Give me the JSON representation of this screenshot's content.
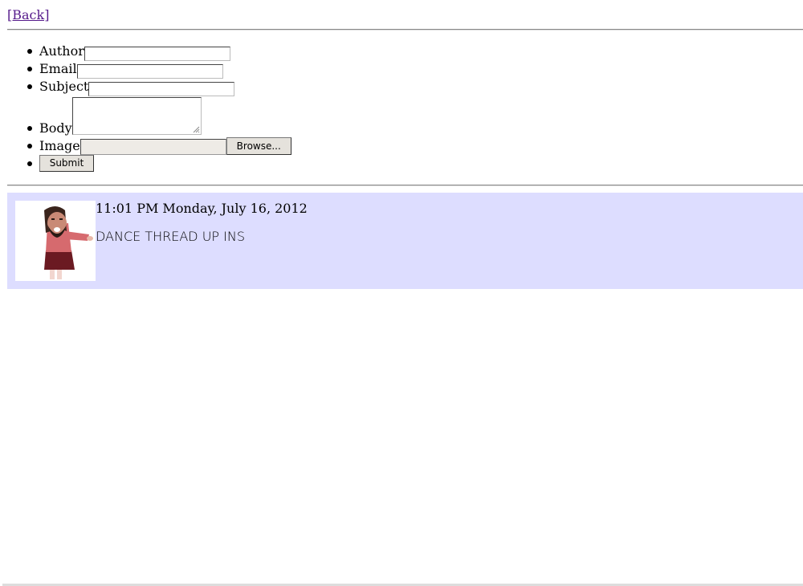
{
  "nav": {
    "back_label": "[Back]"
  },
  "form": {
    "author_label": "Author",
    "email_label": "Email",
    "subject_label": "Subject",
    "body_label": "Body",
    "image_label": "Image",
    "browse_label": "Browse...",
    "submit_label": "Submit",
    "author_value": "",
    "email_value": "",
    "subject_value": ""
  },
  "post": {
    "timestamp": "11:01 PM Monday, July 16, 2012",
    "body": "DANCE THREAD UP INS"
  },
  "colors": {
    "post_bg": "#ddddff",
    "link": "#551a8b"
  }
}
